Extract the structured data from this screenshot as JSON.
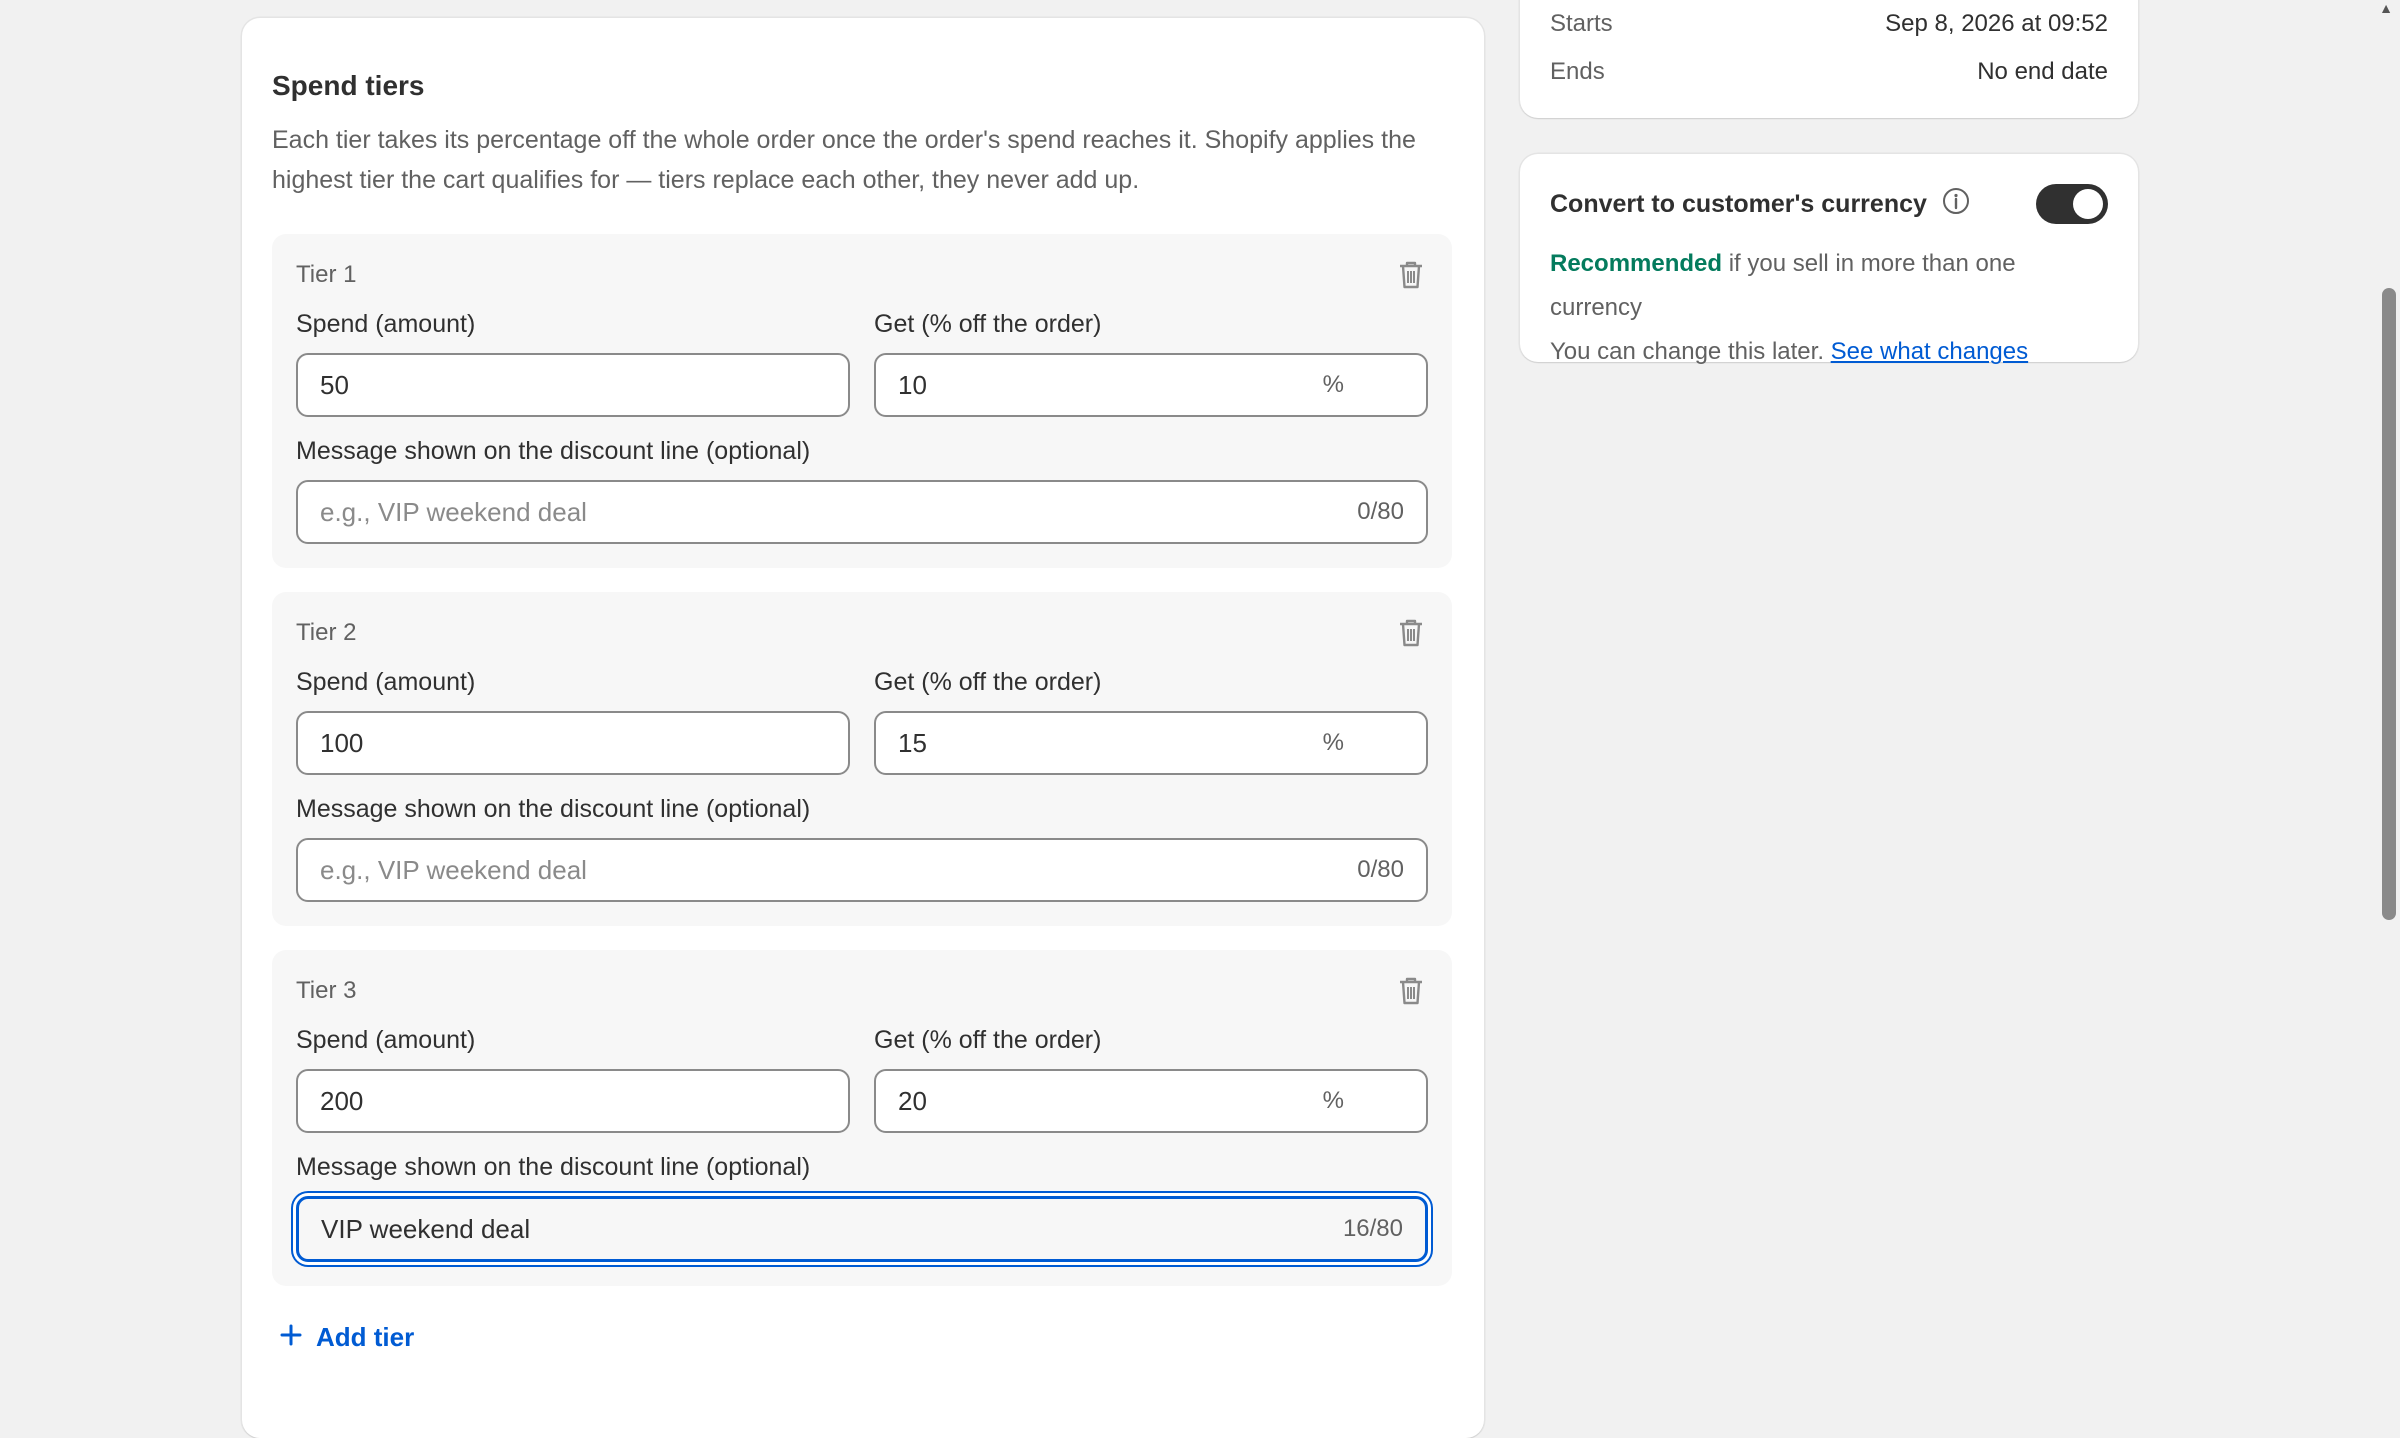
{
  "schedule": {
    "starts_label": "Starts",
    "starts_value": "Sep 8, 2026 at 09:52",
    "ends_label": "Ends",
    "ends_value": "No end date"
  },
  "currency": {
    "title": "Convert to customer's currency",
    "toggle_on": true,
    "recommended": "Recommended",
    "recommended_rest": " if you sell in more than one currency",
    "change_text": "You can change this later. ",
    "link": "See what changes"
  },
  "spend_tiers": {
    "title": "Spend tiers",
    "description": "Each tier takes its percentage off the whole order once the order's spend reaches it. Shopify applies the highest tier the cart qualifies for — tiers replace each other, they never add up.",
    "spend_label": "Spend (amount)",
    "get_label": "Get (% off the order)",
    "percent_suffix": "%",
    "message_label": "Message shown on the discount line (optional)",
    "message_placeholder": "e.g., VIP weekend deal",
    "tiers": [
      {
        "name": "Tier 1",
        "spend": "50",
        "get": "10",
        "message": "",
        "counter": "0/80"
      },
      {
        "name": "Tier 2",
        "spend": "100",
        "get": "15",
        "message": "",
        "counter": "0/80"
      },
      {
        "name": "Tier 3",
        "spend": "200",
        "get": "20",
        "message": "VIP weekend deal",
        "counter": "16/80"
      }
    ],
    "add_tier_label": "Add tier"
  },
  "colors": {
    "accent": "#005bd3",
    "recommended_green": "#047b5d",
    "toggle_on": "#303030"
  }
}
